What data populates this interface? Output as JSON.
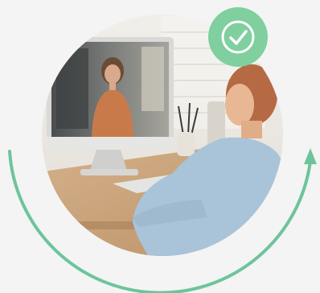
{
  "illustration": {
    "subject": "person-on-video-call-at-desk",
    "badge_icon": "checkmark-icon",
    "arc_icon": "circular-arrow-icon"
  },
  "colors": {
    "background": "#f4f4f4",
    "accent_green": "#6ec49a",
    "badge_green": "#7fcf9f",
    "badge_ring": "#ffffff",
    "desk_wood": "#c9a37a",
    "wall_white": "#e9e6e1",
    "monitor_silver": "#d8d8d6",
    "shirt_blue": "#a9c3d9",
    "hair_red": "#b56a44"
  }
}
